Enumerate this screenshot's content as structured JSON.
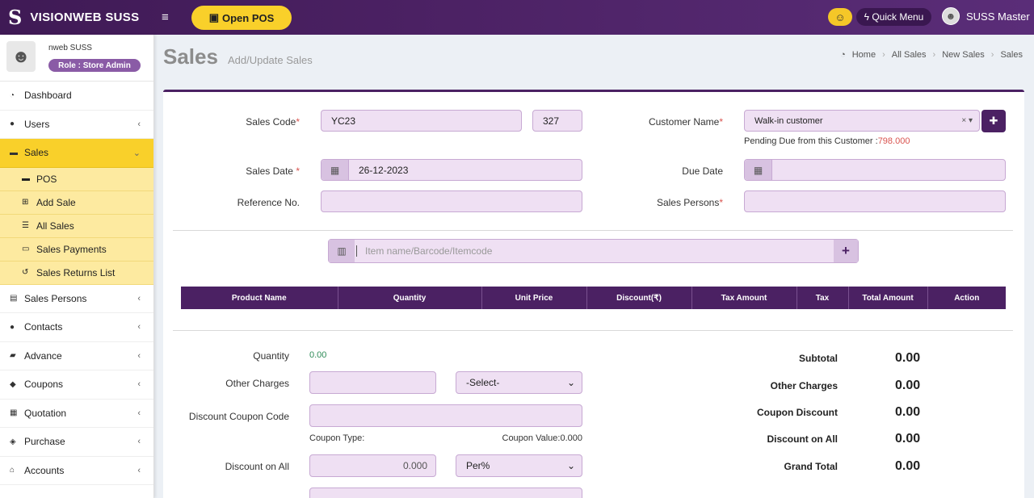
{
  "brand": {
    "logo_letter": "S",
    "name": "VISIONWEB SUSS"
  },
  "topbar": {
    "menu_icon": "≡",
    "open_pos": "Open POS",
    "quick_menu": "Quick Menu",
    "user_name": "SUSS Master"
  },
  "profile": {
    "name": "nweb SUSS",
    "role": "Role : Store Admin"
  },
  "sidebar": {
    "items": [
      {
        "label": "Dashboard",
        "icon": "dashboard-icon"
      },
      {
        "label": "Users",
        "icon": "user-icon"
      },
      {
        "label": "Sales",
        "icon": "cart-icon",
        "active": true
      },
      {
        "label": "Sales Persons",
        "icon": "id-card-icon"
      },
      {
        "label": "Contacts",
        "icon": "users-icon"
      },
      {
        "label": "Advance",
        "icon": "book-icon"
      },
      {
        "label": "Coupons",
        "icon": "tag-icon"
      },
      {
        "label": "Quotation",
        "icon": "calendar-icon"
      },
      {
        "label": "Purchase",
        "icon": "cube-icon"
      },
      {
        "label": "Accounts",
        "icon": "bank-icon"
      }
    ],
    "sales_sub": [
      "POS",
      "Add Sale",
      "All Sales",
      "Sales Payments",
      "Sales Returns List"
    ]
  },
  "page": {
    "title": "Sales",
    "subtitle": "Add/Update Sales"
  },
  "breadcrumb": [
    "Home",
    "All Sales",
    "New Sales",
    "Sales"
  ],
  "form": {
    "sales_code_label": "Sales Code",
    "sales_code_prefix": "YC23",
    "sales_code_number": "327",
    "customer_label": "Customer Name",
    "customer_value": "Walk-in customer",
    "pending_label": "Pending Due from this Customer :",
    "pending_value": "798.000",
    "sales_date_label": "Sales Date ",
    "sales_date_value": "26-12-2023",
    "due_date_label": "Due Date",
    "due_date_value": "",
    "reference_label": "Reference No.",
    "reference_value": "",
    "sales_persons_label": "Sales Persons",
    "sales_persons_value": "",
    "required_mark": "*",
    "item_search_placeholder": "Item name/Barcode/Itemcode"
  },
  "table": {
    "headers": [
      "Product Name",
      "Quantity",
      "Unit Price",
      "Discount(₹)",
      "Tax Amount",
      "Tax",
      "Total Amount",
      "Action"
    ]
  },
  "bottom": {
    "quantity_label": "Quantity",
    "quantity_value": "0.00",
    "other_charges_label": "Other Charges",
    "other_charges_select": "-Select-",
    "coupon_code_label": "Discount Coupon Code",
    "coupon_type_label": "Coupon Type:",
    "coupon_value_label": "Coupon Value:0.000",
    "discount_all_label": "Discount on All",
    "discount_all_value": "0.000",
    "discount_all_select": "Per%"
  },
  "totals": {
    "subtotal_label": "Subtotal",
    "subtotal": "0.00",
    "other_charges_label": "Other Charges",
    "other_charges": "0.00",
    "coupon_discount_label": "Coupon Discount",
    "coupon_discount": "0.00",
    "discount_all_label": "Discount on All",
    "discount_all": "0.00",
    "grand_total_label": "Grand Total",
    "grand_total": "0.00"
  },
  "colors": {
    "primary": "#4b2163",
    "accent": "#f9d02a",
    "input_bg": "#efe0f3",
    "due": "#d9534f"
  }
}
